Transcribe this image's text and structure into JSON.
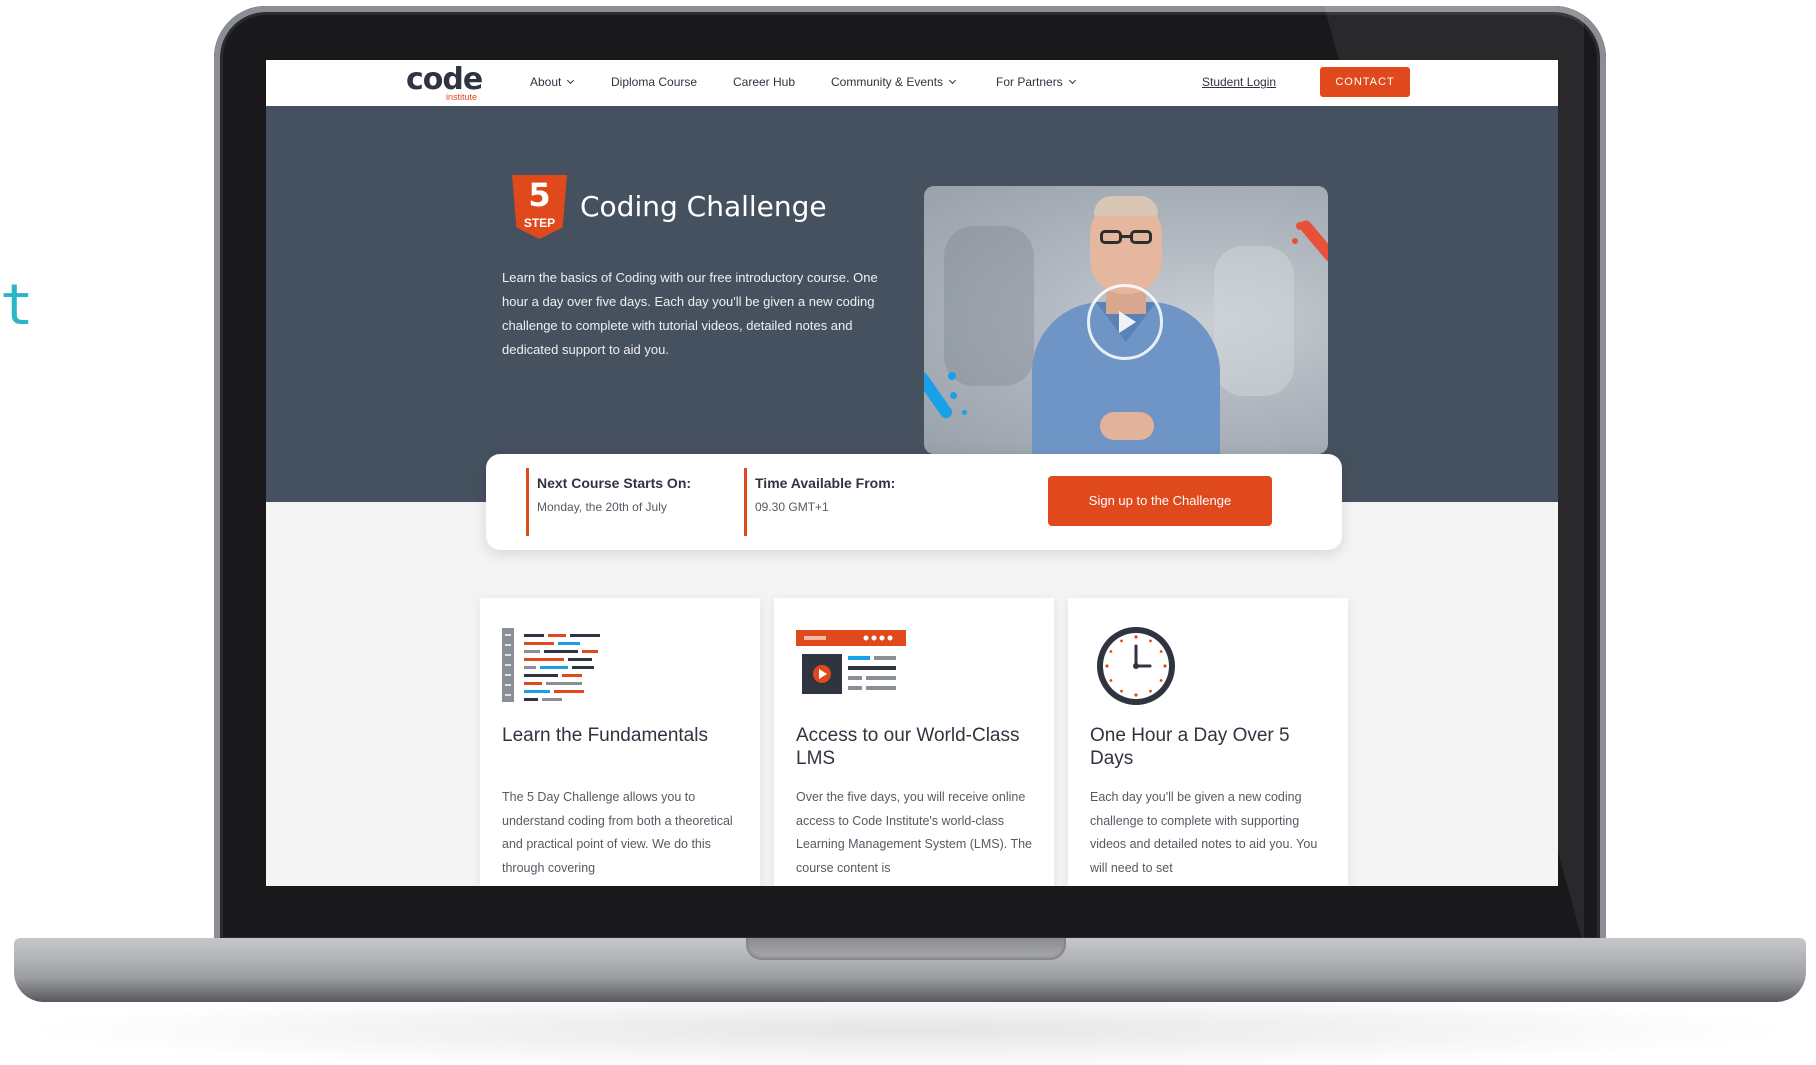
{
  "stray_glyph": "t",
  "nav": {
    "logo_main": "code",
    "logo_sub": "institute",
    "items": [
      "About",
      "Diploma Course",
      "Career Hub",
      "Community & Events",
      "For Partners"
    ],
    "login": "Student Login",
    "contact": "CONTACT"
  },
  "hero": {
    "badge_number": "5",
    "badge_label": "STEP",
    "title": "Coding Challenge",
    "description": "Learn the basics of Coding with our free introductory course. One hour a day over five days. Each day you'll be given a new coding challenge to complete with tutorial videos, detailed notes and dedicated support to aid you."
  },
  "info": {
    "start_label": "Next Course Starts On:",
    "start_value": "Monday, the 20th of July",
    "time_label": "Time Available From:",
    "time_value": "09.30 GMT+1",
    "signup": "Sign up to the Challenge"
  },
  "cards": [
    {
      "icon": "code-editor-icon",
      "title": "Learn the Fundamentals",
      "body": "The 5 Day Challenge allows you to understand coding from both a theoretical and practical point of view. We do this through covering"
    },
    {
      "icon": "lms-video-icon",
      "title": "Access to our World-Class LMS",
      "body": "Over the five days, you will receive online access to Code Institute's world-class Learning Management System (LMS). The course content is"
    },
    {
      "icon": "clock-icon",
      "title": "One Hour a Day Over 5 Days",
      "body": "Each day you'll be given a new coding challenge to complete with supporting videos and detailed notes to aid you. You will need to set"
    }
  ],
  "colors": {
    "accent": "#e0491c",
    "hero_bg": "#46515f",
    "text_dark": "#2f3440",
    "deco_blue": "#1aa0e6"
  }
}
